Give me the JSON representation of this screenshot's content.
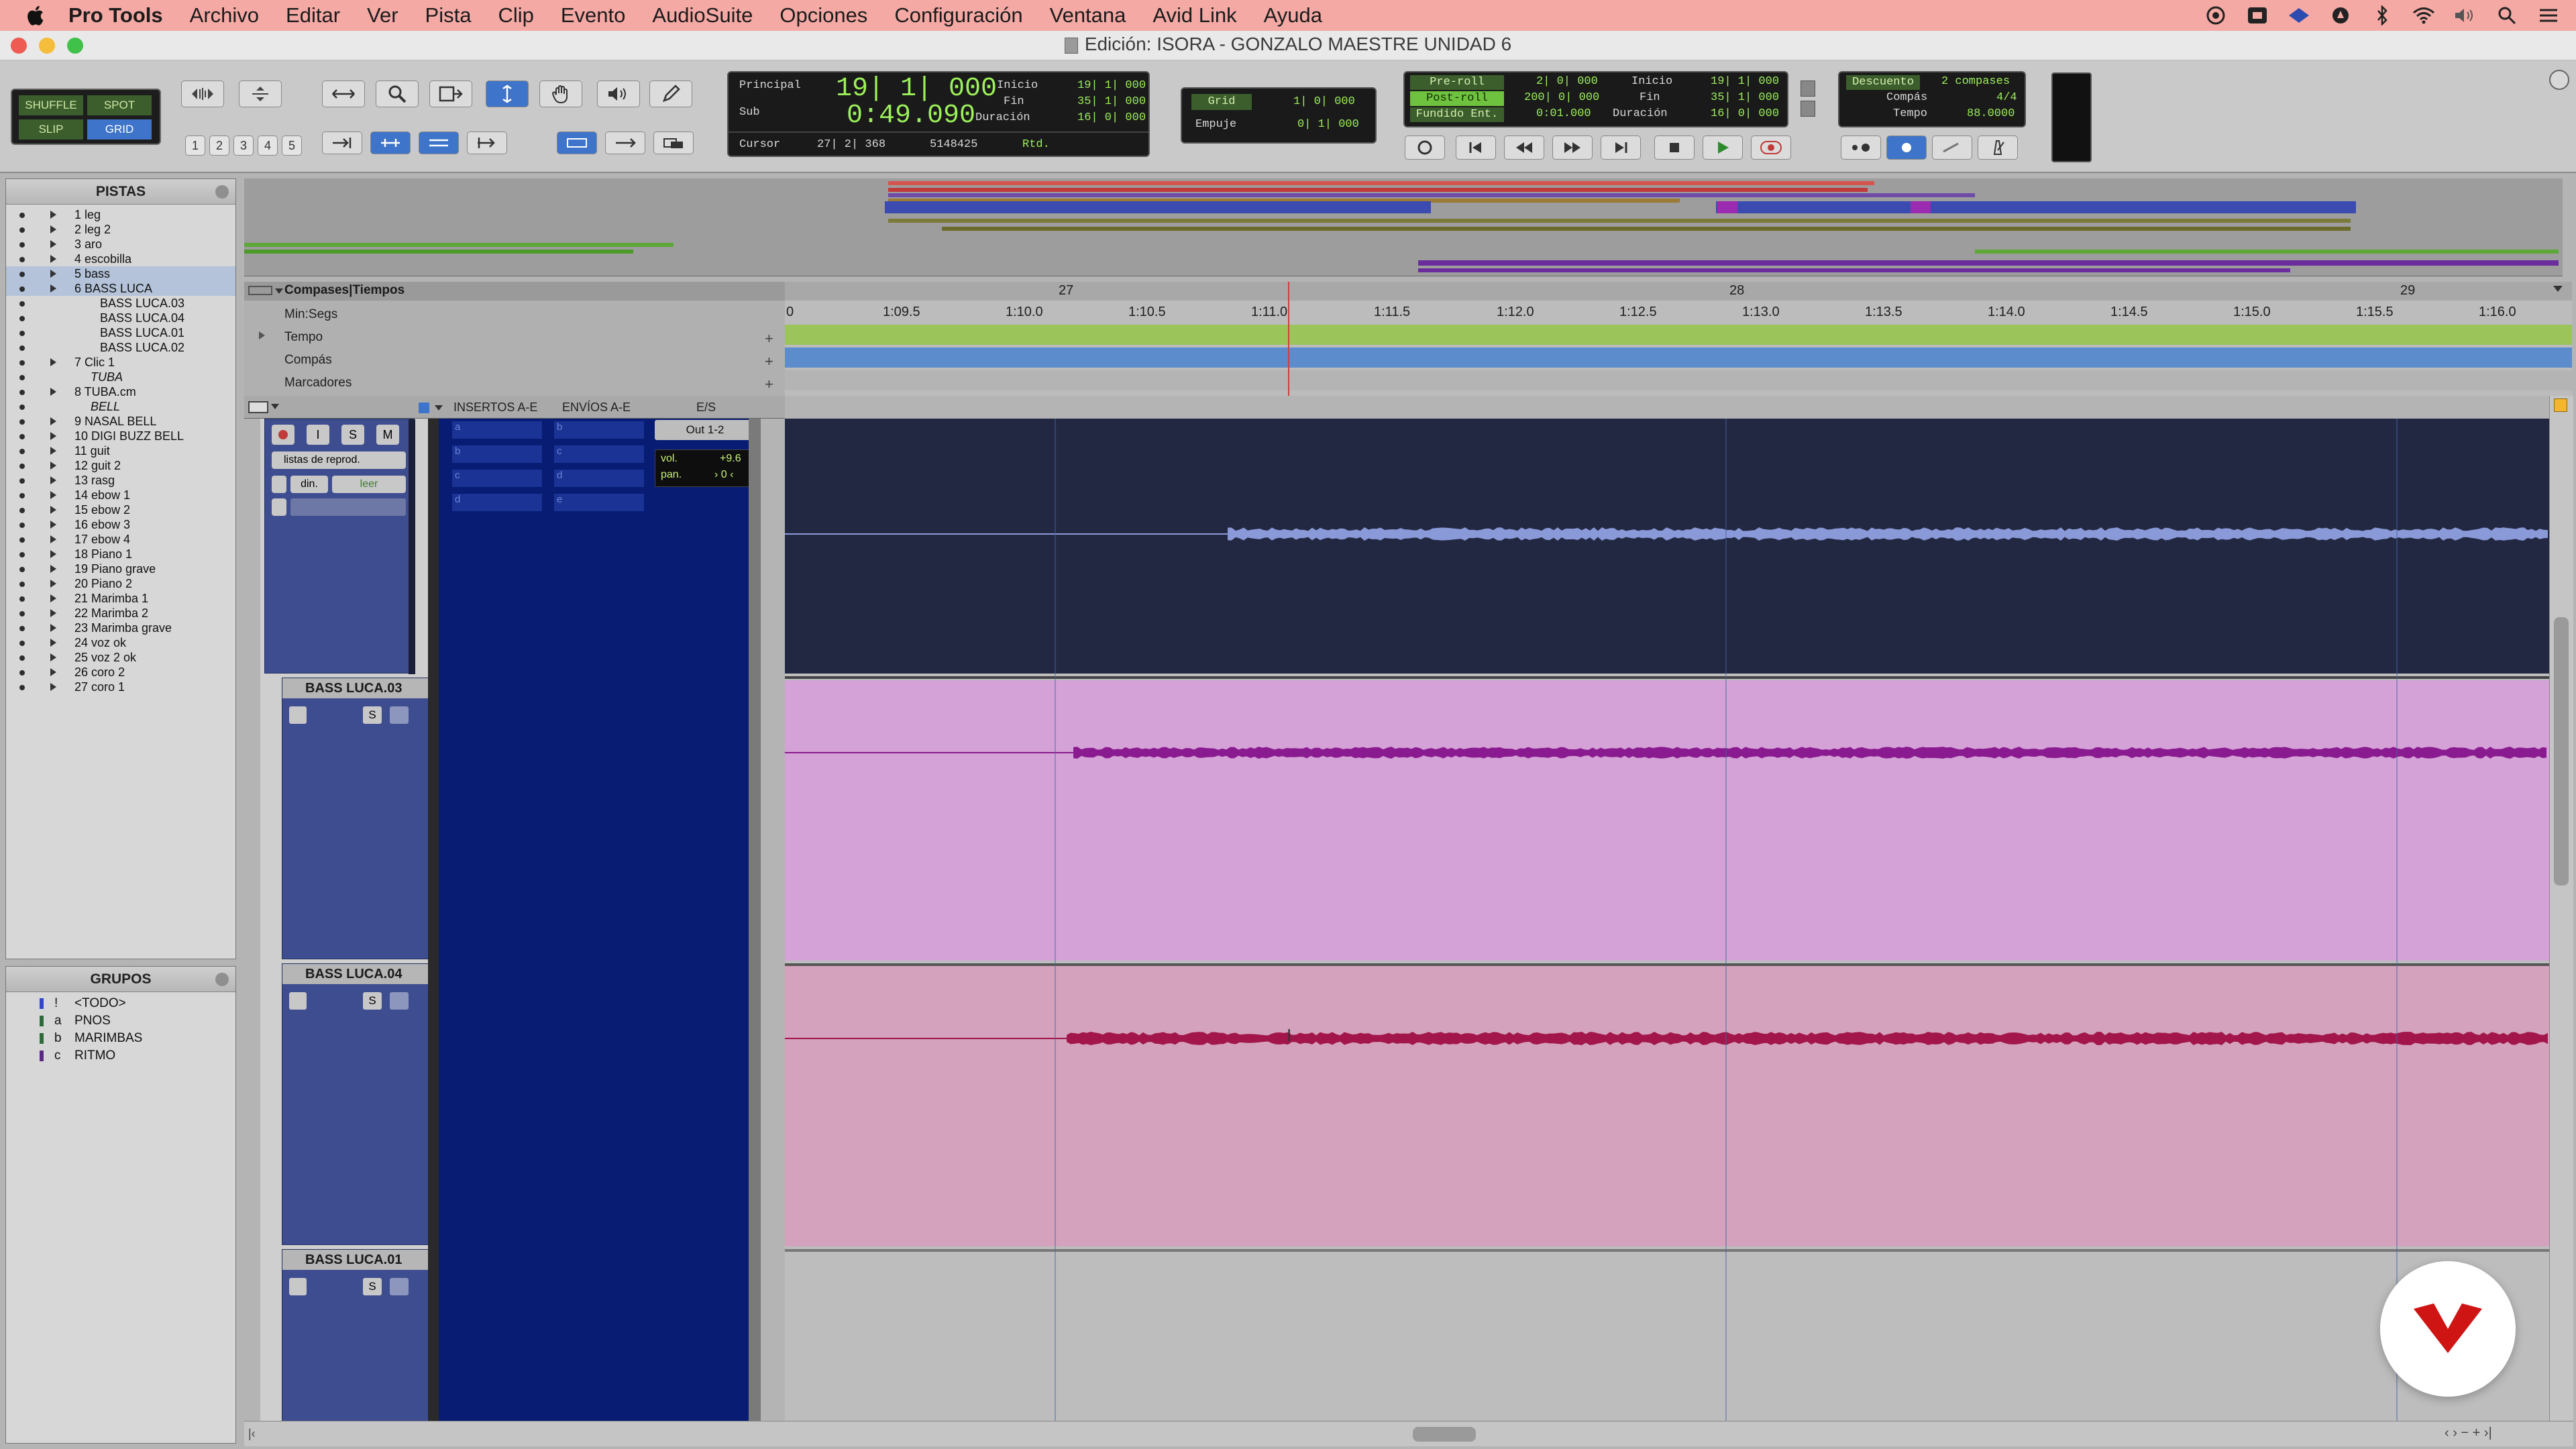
{
  "menubar": {
    "app_name": "Pro Tools",
    "items": [
      "Archivo",
      "Editar",
      "Ver",
      "Pista",
      "Clip",
      "Evento",
      "AudioSuite",
      "Opciones",
      "Configuración",
      "Ventana",
      "Avid Link",
      "Ayuda"
    ]
  },
  "window": {
    "title": "Edición: ISORA - GONZALO MAESTRE UNIDAD 6"
  },
  "toolbar": {
    "modes": [
      "SHUFFLE",
      "SPOT",
      "SLIP",
      "GRID"
    ],
    "zoom_presets": [
      "1",
      "2",
      "3",
      "4",
      "5"
    ],
    "counter": {
      "main_label": "Principal",
      "main_value": "19| 1| 000",
      "sub_label": "Sub",
      "sub_value": "0:49.090",
      "start_label": "Inicio",
      "start_value": "19| 1| 000",
      "end_label": "Fin",
      "end_value": "35| 1| 000",
      "length_label": "Duración",
      "length_value": "16| 0| 000",
      "cursor_label": "Cursor",
      "cursor_value": "27| 2| 368",
      "sample_value": "5148425",
      "rtd_label": "Rtd."
    },
    "grid": {
      "grid_label": "Grid",
      "grid_value": "1| 0| 000",
      "nudge_label": "Empuje",
      "nudge_value": "0| 1| 000"
    },
    "transport_counters": {
      "preroll_label": "Pre-roll",
      "preroll_value": "2| 0| 000",
      "postroll_label": "Post-roll",
      "postroll_value": "200| 0| 000",
      "fadein_label": "Fundido Ent.",
      "fadein_value": "0:01.000",
      "start_label": "Inicio",
      "start_value": "19| 1| 000",
      "end_label": "Fin",
      "end_value": "35| 1| 000",
      "length_label": "Duración",
      "length_value": "16| 0| 000"
    },
    "countoff": {
      "label": "Descuento",
      "bars": "2 compases",
      "meter_label": "Compás",
      "meter_value": "4/4",
      "tempo_label": "Tempo",
      "tempo_value": "88.0000"
    }
  },
  "tracks_panel": {
    "title": "PISTAS",
    "tracks": [
      {
        "label": "1 leg",
        "type": "track"
      },
      {
        "label": "2 leg 2",
        "type": "track"
      },
      {
        "label": "3 aro",
        "type": "track"
      },
      {
        "label": "4 escobilla",
        "type": "track"
      },
      {
        "label": "5 bass",
        "type": "track",
        "selected": true
      },
      {
        "label": "6 BASS LUCA",
        "type": "track",
        "selected": true
      },
      {
        "label": "BASS LUCA.03",
        "type": "sub"
      },
      {
        "label": "BASS LUCA.04",
        "type": "sub"
      },
      {
        "label": "BASS LUCA.01",
        "type": "sub"
      },
      {
        "label": "BASS LUCA.02",
        "type": "sub"
      },
      {
        "label": "7 Clic 1",
        "type": "track"
      },
      {
        "label": "TUBA",
        "type": "italic"
      },
      {
        "label": "8 TUBA.cm",
        "type": "track"
      },
      {
        "label": "BELL",
        "type": "italic"
      },
      {
        "label": "9 NASAL BELL",
        "type": "track"
      },
      {
        "label": "10 DIGI BUZZ BELL",
        "type": "track"
      },
      {
        "label": "11 guit",
        "type": "track"
      },
      {
        "label": "12 guit 2",
        "type": "track"
      },
      {
        "label": "13 rasg",
        "type": "track"
      },
      {
        "label": "14 ebow 1",
        "type": "track"
      },
      {
        "label": "15 ebow 2",
        "type": "track"
      },
      {
        "label": "16 ebow 3",
        "type": "track"
      },
      {
        "label": "17 ebow 4",
        "type": "track"
      },
      {
        "label": "18 Piano 1",
        "type": "track"
      },
      {
        "label": "19 Piano grave",
        "type": "track"
      },
      {
        "label": "20 Piano 2",
        "type": "track"
      },
      {
        "label": "21 Marimba 1",
        "type": "track"
      },
      {
        "label": "22 Marimba 2",
        "type": "track"
      },
      {
        "label": "23 Marimba grave",
        "type": "track"
      },
      {
        "label": "24 voz ok",
        "type": "track"
      },
      {
        "label": "25 voz 2 ok",
        "type": "track"
      },
      {
        "label": "26 coro 2",
        "type": "track"
      },
      {
        "label": "27 coro 1",
        "type": "track"
      }
    ]
  },
  "groups_panel": {
    "title": "GRUPOS",
    "groups": [
      {
        "letter": "!",
        "name": "<TODO>",
        "color": "#3246c8"
      },
      {
        "letter": "a",
        "name": "PNOS",
        "color": "#2f6b3a"
      },
      {
        "letter": "b",
        "name": "MARIMBAS",
        "color": "#2f6b3a"
      },
      {
        "letter": "c",
        "name": "RITMO",
        "color": "#5a2a82"
      }
    ]
  },
  "rulers": {
    "labels": [
      "Compases|Tiempos",
      "Min:Segs",
      "Tempo",
      "Compás",
      "Marcadores"
    ],
    "bars": [
      "27",
      "28",
      "29"
    ],
    "minsecs": [
      "1:09.5",
      "1:10.0",
      "1:10.5",
      "1:11.0",
      "1:11.5",
      "1:12.0",
      "1:12.5",
      "1:13.0",
      "1:13.5",
      "1:14.0",
      "1:14.5",
      "1:15.0",
      "1:15.5",
      "1:16.0"
    ],
    "minsec_first": "0"
  },
  "edit_columns": {
    "inserts_header": "INSERTOS A-E",
    "sends_header": "ENVÍOS A-E",
    "io_header": "E/S",
    "output": "Out 1-2",
    "playlist": "listas de reprod.",
    "auto_mode_label": "din.",
    "auto_read": "leer",
    "vol_label": "vol.",
    "vol_value": "+9.6",
    "pan_label": "pan.",
    "pan_value": "› 0 ‹",
    "insert_slots": [
      "a",
      "b",
      "c",
      "d",
      "e"
    ],
    "track_buttons": [
      "S",
      "M"
    ]
  },
  "playlists": [
    {
      "name": "BASS LUCA.03",
      "solo": "S",
      "color": "#d4a2d7",
      "wave": "#8a1a8f"
    },
    {
      "name": "BASS LUCA.04",
      "solo": "S",
      "color": "#d4a2bc",
      "wave": "#a2164b"
    },
    {
      "name": "BASS LUCA.01",
      "solo": "S",
      "color": "#bdbdbd",
      "wave": "#555555"
    }
  ],
  "colors": {
    "menubar": "#f4a9a4",
    "main_track_bg": "#232842",
    "main_wave": "#8a9ad8",
    "selection_blue": "#071c72",
    "playhead": "#d43c3c"
  }
}
